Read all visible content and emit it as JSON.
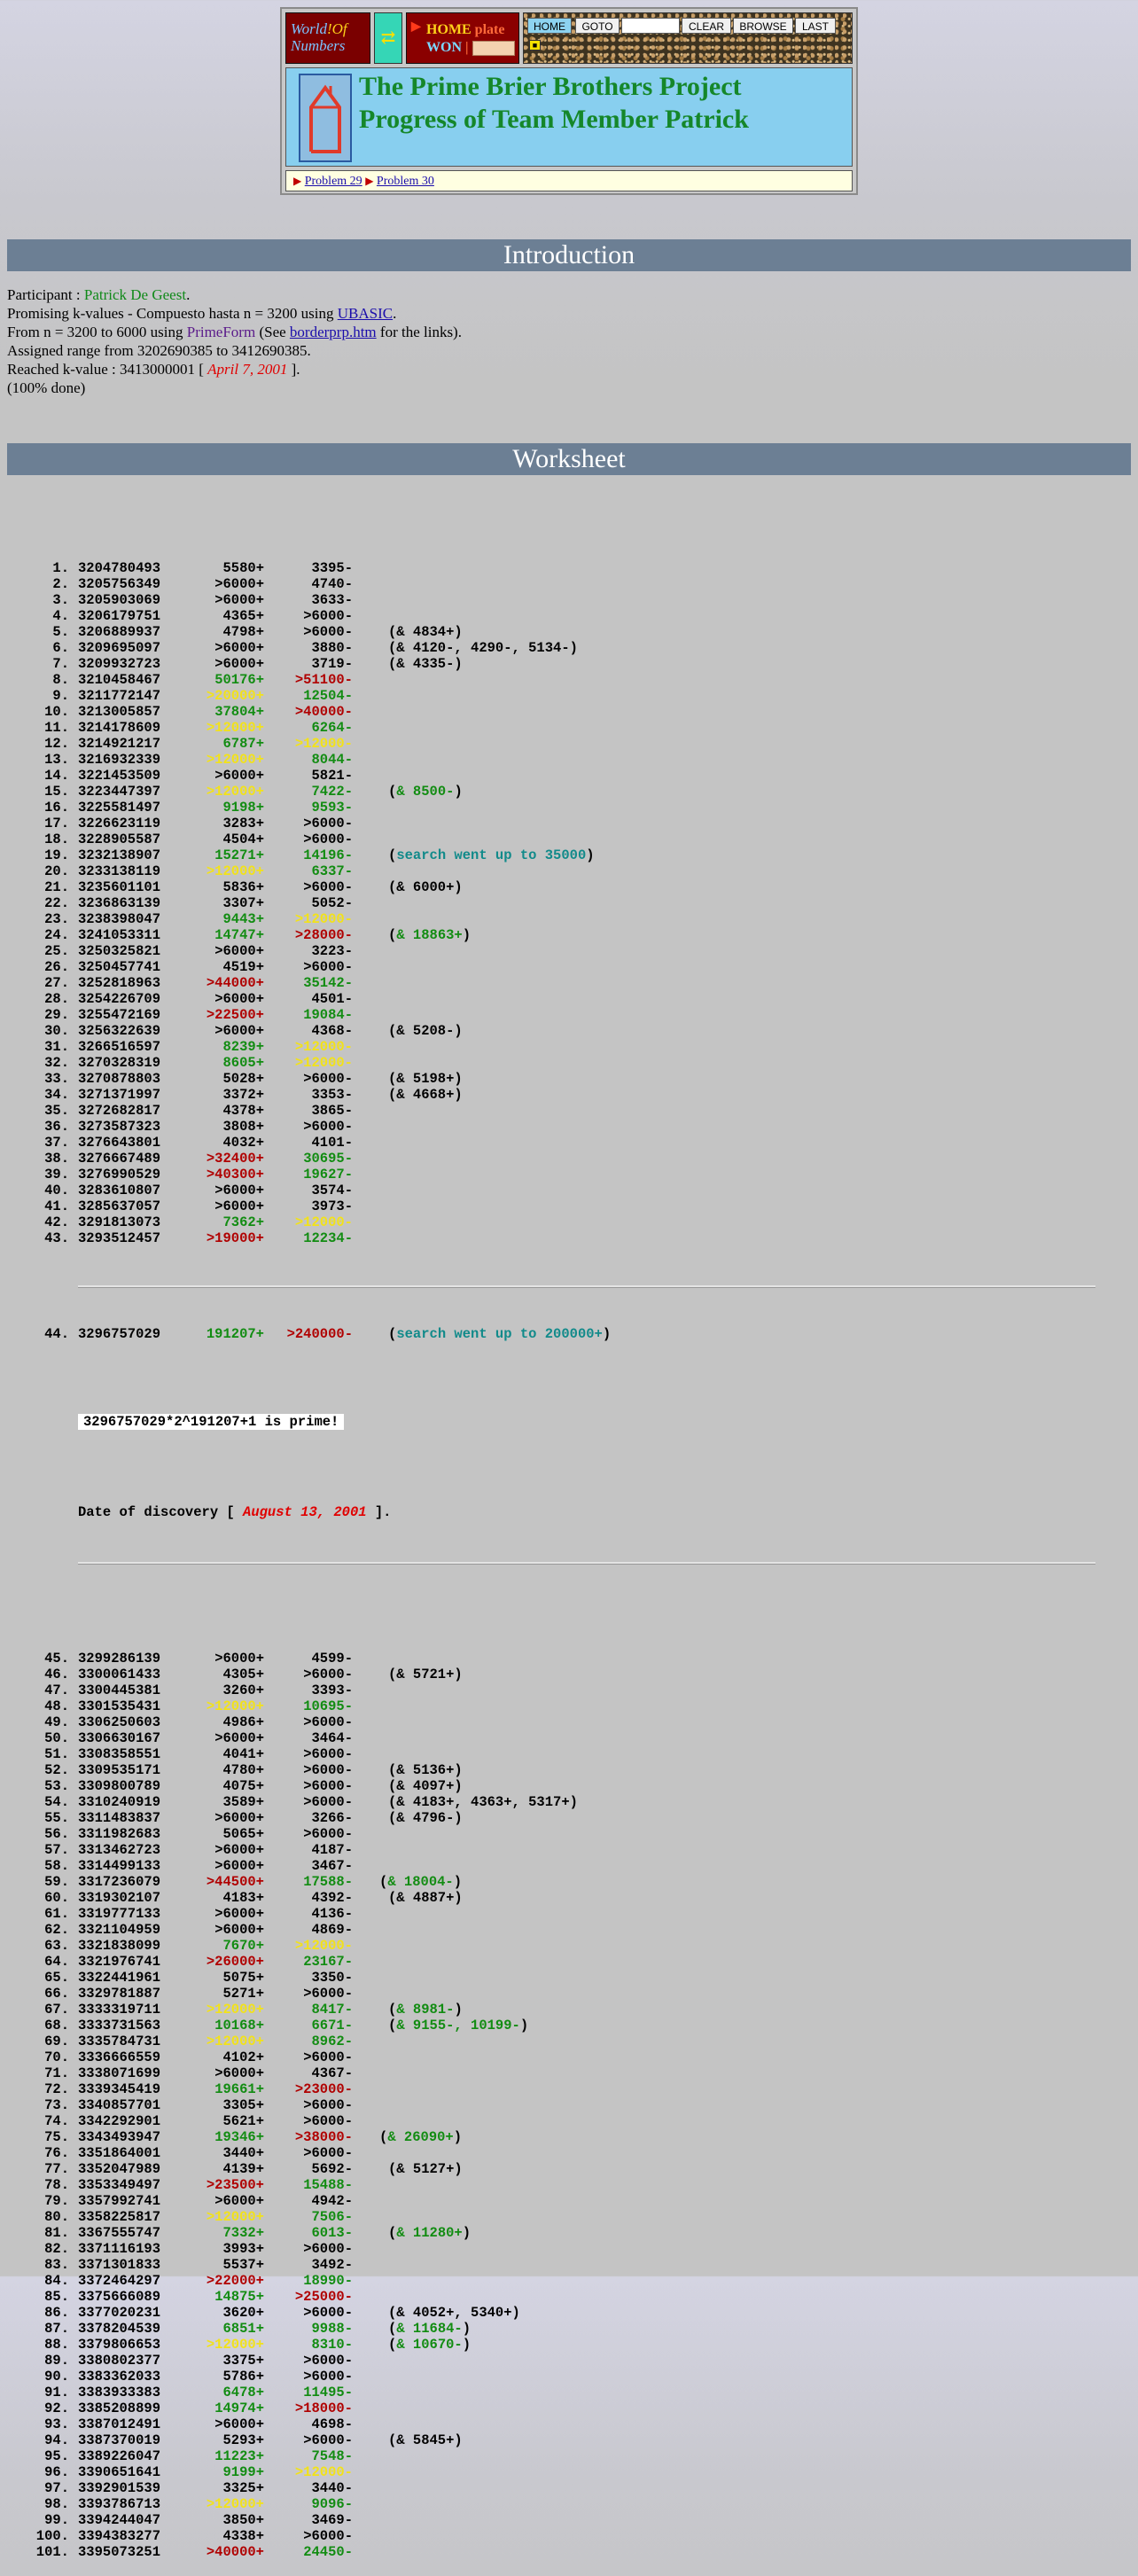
{
  "header": {
    "logo_line1_w": "W",
    "logo_line1_rest": "orld",
    "logo_line1_of": "!Of",
    "logo_line2_n": "N",
    "logo_line2_rest": "umbers",
    "swap_glyph": "⇄",
    "home_word": "HOME",
    "plate_word": "plate",
    "won_word": "WON",
    "nav_buttons": [
      "HOME",
      "GOTO",
      "CLEAR",
      "BROWSE",
      "LAST"
    ],
    "title_line1": "The Prime Brier Brothers Project",
    "title_line2": "Progress of Team Member Patrick",
    "problem_links": [
      "Problem 29",
      "Problem 30"
    ]
  },
  "sections": {
    "intro": "Introduction",
    "worksheet": "Worksheet"
  },
  "intro": {
    "participant_label": "Participant : ",
    "participant_name": "Patrick De Geest",
    "participant_end": ".",
    "line2_pre": "Promising k-values - Compuesto hasta n = 3200 using ",
    "line2_link": "UBASIC",
    "line2_end": ".",
    "line3_pre": "From n = 3200 to 6000 using ",
    "line3_prog": "PrimeForm",
    "line3_mid": " (See ",
    "line3_link": "borderprp.htm",
    "line3_end": " for the links).",
    "line4": "Assigned range from 3202690385 to 3412690385.",
    "line5_pre": "Reached k-value : 3413000001 [ ",
    "line5_date": "April 7, 2001",
    "line5_end": " ].",
    "line6": "(100% done)"
  },
  "worksheet": {
    "rows_a": [
      [
        "1.",
        "3204780493",
        "5580+",
        "",
        "3395-",
        "",
        "",
        ""
      ],
      [
        "2.",
        "3205756349",
        ">6000+",
        "",
        "4740-",
        "",
        "",
        ""
      ],
      [
        "3.",
        "3205903069",
        ">6000+",
        "",
        "3633-",
        "",
        "",
        ""
      ],
      [
        "4.",
        "3206179751",
        "4365+",
        "",
        ">6000-",
        "",
        "",
        ""
      ],
      [
        "5.",
        "3206889937",
        "4798+",
        "",
        ">6000-",
        "",
        "(& 4834+)",
        ""
      ],
      [
        "6.",
        "3209695097",
        ">6000+",
        "",
        "3880-",
        "",
        "(& 4120-, 4290-, 5134-)",
        ""
      ],
      [
        "7.",
        "3209932723",
        ">6000+",
        "",
        "3719-",
        "",
        "(& 4335-)",
        ""
      ],
      [
        "8.",
        "3210458467",
        "50176+",
        "g",
        ">51100-",
        "r",
        "",
        ""
      ],
      [
        "9.",
        "3211772147",
        ">20000+",
        "y",
        "12504-",
        "g",
        "",
        ""
      ],
      [
        "10.",
        "3213005857",
        "37804+",
        "g",
        ">40000-",
        "r",
        "",
        ""
      ],
      [
        "11.",
        "3214178609",
        ">12000+",
        "y",
        "6264-",
        "g",
        "",
        ""
      ],
      [
        "12.",
        "3214921217",
        "6787+",
        "g",
        ">12000-",
        "y",
        "",
        ""
      ],
      [
        "13.",
        "3216932339",
        ">12000+",
        "y",
        "8044-",
        "g",
        "",
        ""
      ],
      [
        "14.",
        "3221453509",
        ">6000+",
        "",
        "5821-",
        "",
        "",
        ""
      ],
      [
        "15.",
        "3223447397",
        ">12000+",
        "y",
        "7422-",
        "g",
        "& 8500-",
        "g"
      ],
      [
        "16.",
        "3225581497",
        "9198+",
        "g",
        "9593-",
        "g",
        "",
        ""
      ],
      [
        "17.",
        "3226623119",
        "3283+",
        "",
        ">6000-",
        "",
        "",
        ""
      ],
      [
        "18.",
        "3228905587",
        "4504+",
        "",
        ">6000-",
        "",
        "",
        ""
      ],
      [
        "19.",
        "3232138907",
        "15271+",
        "g",
        "14196-",
        "g",
        "search went up to 35000",
        "t"
      ],
      [
        "20.",
        "3233138119",
        ">12000+",
        "y",
        "6337-",
        "g",
        "",
        ""
      ],
      [
        "21.",
        "3235601101",
        "5836+",
        "",
        ">6000-",
        "",
        "(& 6000+)",
        ""
      ],
      [
        "22.",
        "3236863139",
        "3307+",
        "",
        "5052-",
        "",
        "",
        ""
      ],
      [
        "23.",
        "3238398047",
        "9443+",
        "g",
        ">12000-",
        "y",
        "",
        ""
      ],
      [
        "24.",
        "3241053311",
        "14747+",
        "g",
        ">28000-",
        "r",
        "& 18863+",
        "g"
      ],
      [
        "25.",
        "3250325821",
        ">6000+",
        "",
        "3223-",
        "",
        "",
        ""
      ],
      [
        "26.",
        "3250457741",
        "4519+",
        "",
        ">6000-",
        "",
        "",
        ""
      ],
      [
        "27.",
        "3252818963",
        ">44000+",
        "r",
        "35142-",
        "g",
        "",
        ""
      ],
      [
        "28.",
        "3254226709",
        ">6000+",
        "",
        "4501-",
        "",
        "",
        ""
      ],
      [
        "29.",
        "3255472169",
        ">22500+",
        "r",
        "19084-",
        "g",
        "",
        ""
      ],
      [
        "30.",
        "3256322639",
        ">6000+",
        "",
        "4368-",
        "",
        "(& 5208-)",
        ""
      ],
      [
        "31.",
        "3266516597",
        "8239+",
        "g",
        ">12000-",
        "y",
        "",
        ""
      ],
      [
        "32.",
        "3270328319",
        "8605+",
        "g",
        ">12000-",
        "y",
        "",
        ""
      ],
      [
        "33.",
        "3270878803",
        "5028+",
        "",
        ">6000-",
        "",
        "(& 5198+)",
        ""
      ],
      [
        "34.",
        "3271371997",
        "3372+",
        "",
        "3353-",
        "",
        "(& 4668+)",
        ""
      ],
      [
        "35.",
        "3272682817",
        "4378+",
        "",
        "3865-",
        "",
        "",
        ""
      ],
      [
        "36.",
        "3273587323",
        "3808+",
        "",
        ">6000-",
        "",
        "",
        ""
      ],
      [
        "37.",
        "3276643801",
        "4032+",
        "",
        "4101-",
        "",
        "",
        ""
      ],
      [
        "38.",
        "3276667489",
        ">32400+",
        "r",
        "30695-",
        "g",
        "",
        ""
      ],
      [
        "39.",
        "3276990529",
        ">40300+",
        "r",
        "19627-",
        "g",
        "",
        ""
      ],
      [
        "40.",
        "3283610807",
        ">6000+",
        "",
        "3574-",
        "",
        "",
        ""
      ],
      [
        "41.",
        "3285637057",
        ">6000+",
        "",
        "3973-",
        "",
        "",
        ""
      ],
      [
        "42.",
        "3291813073",
        "7362+",
        "g",
        ">12000-",
        "y",
        "",
        ""
      ],
      [
        "43.",
        "3293512457",
        ">19000+",
        "r",
        "12234-",
        "g",
        "",
        ""
      ]
    ],
    "row_44": [
      "44.",
      "3296757029",
      "191207+",
      "g",
      ">240000-",
      "r",
      "search went up to 200000+",
      "t"
    ],
    "prime_text": "3296757029*2^191207+1 is prime!",
    "discovery_pre": "Date of discovery [ ",
    "discovery_date": "August 13, 2001",
    "discovery_end": " ].",
    "rows_b": [
      [
        "45.",
        "3299286139",
        ">6000+",
        "",
        "4599-",
        "",
        "",
        ""
      ],
      [
        "46.",
        "3300061433",
        "4305+",
        "",
        ">6000-",
        "",
        "(& 5721+)",
        ""
      ],
      [
        "47.",
        "3300445381",
        "3260+",
        "",
        "3393-",
        "",
        "",
        ""
      ],
      [
        "48.",
        "3301535431",
        ">12000+",
        "y",
        "10695-",
        "g",
        "",
        ""
      ],
      [
        "49.",
        "3306250603",
        "4986+",
        "",
        ">6000-",
        "",
        "",
        ""
      ],
      [
        "50.",
        "3306630167",
        ">6000+",
        "",
        "3464-",
        "",
        "",
        ""
      ],
      [
        "51.",
        "3308358551",
        "4041+",
        "",
        ">6000-",
        "",
        "",
        ""
      ],
      [
        "52.",
        "3309535171",
        "4780+",
        "",
        ">6000-",
        "",
        "(& 5136+)",
        ""
      ],
      [
        "53.",
        "3309800789",
        "4075+",
        "",
        ">6000-",
        "",
        "(& 4097+)",
        ""
      ],
      [
        "54.",
        "3310240919",
        "3589+",
        "",
        ">6000-",
        "",
        "(& 4183+, 4363+, 5317+)",
        ""
      ],
      [
        "55.",
        "3311483837",
        ">6000+",
        "",
        "3266-",
        "",
        "(& 4796-)",
        ""
      ],
      [
        "56.",
        "3311982683",
        "5065+",
        "",
        ">6000-",
        "",
        "",
        ""
      ],
      [
        "57.",
        "3313462723",
        ">6000+",
        "",
        "4187-",
        "",
        "",
        ""
      ],
      [
        "58.",
        "3314499133",
        ">6000+",
        "",
        "3467-",
        "",
        "",
        ""
      ],
      [
        "59.",
        "3317236079",
        ">44500+",
        "r",
        "17588-",
        "g",
        "& 18004-",
        "g2"
      ],
      [
        "60.",
        "3319302107",
        "4183+",
        "",
        "4392-",
        "",
        "(& 4887+)",
        ""
      ],
      [
        "61.",
        "3319777133",
        ">6000+",
        "",
        "4136-",
        "",
        "",
        ""
      ],
      [
        "62.",
        "3321104959",
        ">6000+",
        "",
        "4869-",
        "",
        "",
        ""
      ],
      [
        "63.",
        "3321838099",
        "7670+",
        "g",
        ">12000-",
        "y",
        "",
        ""
      ],
      [
        "64.",
        "3321976741",
        ">26000+",
        "r",
        "23167-",
        "g",
        "",
        ""
      ],
      [
        "65.",
        "3322441961",
        "5075+",
        "",
        "3350-",
        "",
        "",
        ""
      ],
      [
        "66.",
        "3329781887",
        "5271+",
        "",
        ">6000-",
        "",
        "",
        ""
      ],
      [
        "67.",
        "3333319711",
        ">12000+",
        "y",
        "8417-",
        "g",
        "& 8981-",
        "g"
      ],
      [
        "68.",
        "3333731563",
        "10168+",
        "g",
        "6671-",
        "g",
        "& 9155-, 10199-",
        "g"
      ],
      [
        "69.",
        "3335784731",
        ">12000+",
        "y",
        "8962-",
        "g",
        "",
        ""
      ],
      [
        "70.",
        "3336666559",
        "4102+",
        "",
        ">6000-",
        "",
        "",
        ""
      ],
      [
        "71.",
        "3338071699",
        ">6000+",
        "",
        "4367-",
        "",
        "",
        ""
      ],
      [
        "72.",
        "3339345419",
        "19661+",
        "g",
        ">23000-",
        "r",
        "",
        ""
      ],
      [
        "73.",
        "3340857701",
        "3305+",
        "",
        ">6000-",
        "",
        "",
        ""
      ],
      [
        "74.",
        "3342292901",
        "5621+",
        "",
        ">6000-",
        "",
        "",
        ""
      ],
      [
        "75.",
        "3343493947",
        "19346+",
        "g",
        ">38000-",
        "r",
        "& 26090+",
        "g2"
      ],
      [
        "76.",
        "3351864001",
        "3440+",
        "",
        ">6000-",
        "",
        "",
        ""
      ],
      [
        "77.",
        "3352047989",
        "4139+",
        "",
        "5692-",
        "",
        "(& 5127+)",
        ""
      ],
      [
        "78.",
        "3353349497",
        ">23500+",
        "r",
        "15488-",
        "g",
        "",
        ""
      ],
      [
        "79.",
        "3357992741",
        ">6000+",
        "",
        "4942-",
        "",
        "",
        ""
      ],
      [
        "80.",
        "3358225817",
        ">12000+",
        "y",
        "7506-",
        "g",
        "",
        ""
      ],
      [
        "81.",
        "3367555747",
        "7332+",
        "g",
        "6013-",
        "g",
        "& 11280+",
        "g"
      ],
      [
        "82.",
        "3371116193",
        "3993+",
        "",
        ">6000-",
        "",
        "",
        ""
      ],
      [
        "83.",
        "3371301833",
        "5537+",
        "",
        "3492-",
        "",
        "",
        ""
      ],
      [
        "84.",
        "3372464297",
        ">22000+",
        "r",
        "18990-",
        "g",
        "",
        ""
      ],
      [
        "85.",
        "3375666089",
        "14875+",
        "g",
        ">25000-",
        "r",
        "",
        ""
      ],
      [
        "86.",
        "3377020231",
        "3620+",
        "",
        ">6000-",
        "",
        "(& 4052+, 5340+)",
        ""
      ],
      [
        "87.",
        "3378204539",
        "6851+",
        "g",
        "9988-",
        "g",
        "& 11684-",
        "g"
      ],
      [
        "88.",
        "3379806653",
        ">12000+",
        "y",
        "8310-",
        "g",
        "& 10670-",
        "g"
      ],
      [
        "89.",
        "3380802377",
        "3375+",
        "",
        ">6000-",
        "",
        "",
        ""
      ],
      [
        "90.",
        "3383362033",
        "5786+",
        "",
        ">6000-",
        "",
        "",
        ""
      ],
      [
        "91.",
        "3383933383",
        "6478+",
        "g",
        "11495-",
        "g",
        "",
        ""
      ],
      [
        "92.",
        "3385208899",
        "14974+",
        "g",
        ">18000-",
        "r",
        "",
        ""
      ],
      [
        "93.",
        "3387012491",
        ">6000+",
        "",
        "4698-",
        "",
        "",
        ""
      ],
      [
        "94.",
        "3387370019",
        "5293+",
        "",
        ">6000-",
        "",
        "(& 5845+)",
        ""
      ],
      [
        "95.",
        "3389226047",
        "11223+",
        "g",
        "7548-",
        "g",
        "",
        ""
      ],
      [
        "96.",
        "3390651641",
        "9199+",
        "g",
        ">12000-",
        "y",
        "",
        ""
      ],
      [
        "97.",
        "3392901539",
        "3325+",
        "",
        "3440-",
        "",
        "",
        ""
      ],
      [
        "98.",
        "3393786713",
        ">12000+",
        "y",
        "9096-",
        "g",
        "",
        ""
      ],
      [
        "99.",
        "3394244047",
        "3850+",
        "",
        "3469-",
        "",
        "",
        ""
      ],
      [
        "100.",
        "3394383277",
        "4338+",
        "",
        ">6000-",
        "",
        "",
        ""
      ],
      [
        "101.",
        "3395073251",
        ">40000+",
        "r",
        "24450-",
        "g",
        "",
        ""
      ]
    ]
  },
  "colors": {
    "section_bar": "#6c7f94",
    "title_green": "#15872a",
    "title_box": "#88cfef",
    "yellow": "#f2e21a",
    "green": "#128c12",
    "red": "#b00000",
    "teal": "#118a8a"
  }
}
